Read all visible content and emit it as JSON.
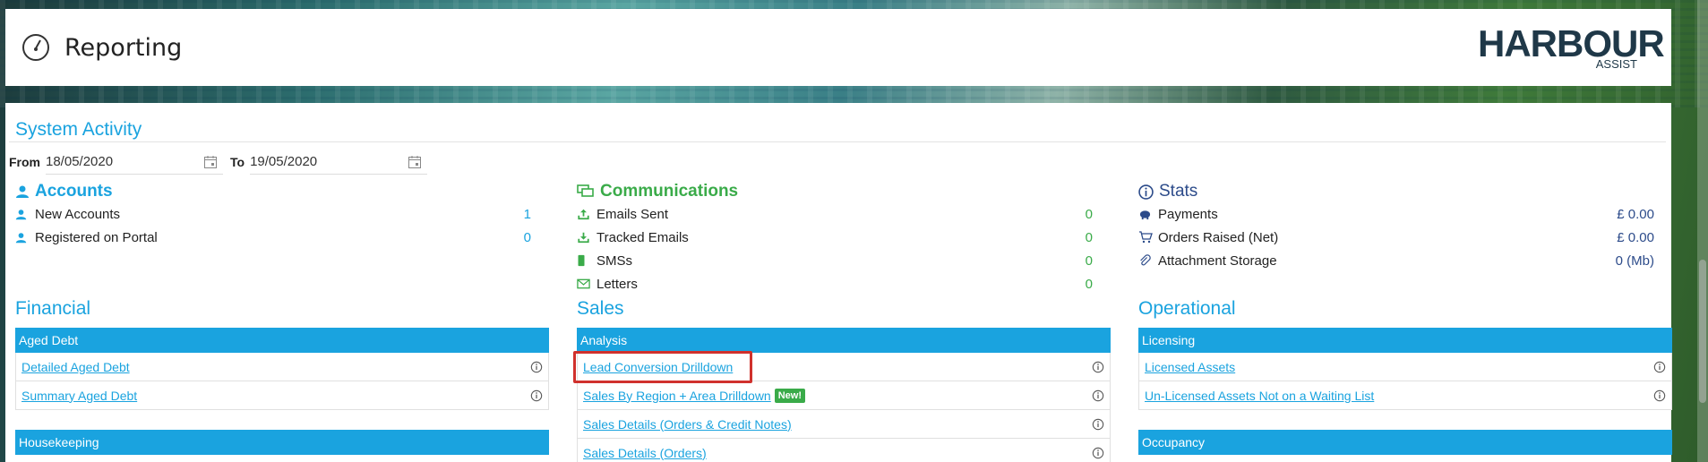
{
  "header": {
    "title": "Reporting",
    "logo_main": "HARBOUR",
    "logo_sub": "ASSIST"
  },
  "system_activity": {
    "title": "System Activity",
    "from_label": "From",
    "from_value": "18/05/2020",
    "to_label": "To",
    "to_value": "19/05/2020"
  },
  "accounts": {
    "title": "Accounts",
    "rows": [
      {
        "label": "New Accounts",
        "value": "1"
      },
      {
        "label": "Registered on Portal",
        "value": "0"
      }
    ]
  },
  "communications": {
    "title": "Communications",
    "rows": [
      {
        "label": "Emails Sent",
        "value": "0"
      },
      {
        "label": "Tracked Emails",
        "value": "0"
      },
      {
        "label": "SMSs",
        "value": "0"
      },
      {
        "label": "Letters",
        "value": "0"
      }
    ]
  },
  "stats": {
    "title": "Stats",
    "rows": [
      {
        "label": "Payments",
        "value": "£ 0.00"
      },
      {
        "label": "Orders Raised (Net)",
        "value": "£ 0.00"
      },
      {
        "label": "Attachment Storage",
        "value": "0 (Mb)"
      }
    ]
  },
  "financial": {
    "title": "Financial",
    "aged_debt": {
      "header": "Aged Debt",
      "links": [
        "Detailed Aged Debt",
        "Summary Aged Debt"
      ]
    },
    "housekeeping": {
      "header": "Housekeeping"
    }
  },
  "sales": {
    "title": "Sales",
    "analysis": {
      "header": "Analysis",
      "links": [
        "Lead Conversion Drilldown",
        "Sales By Region + Area Drilldown",
        "Sales Details (Orders & Credit Notes)",
        "Sales Details (Orders)"
      ],
      "new_badge": "New!"
    }
  },
  "operational": {
    "title": "Operational",
    "licensing": {
      "header": "Licensing",
      "links": [
        "Licensed Assets",
        "Un-Licensed Assets Not on a Waiting List"
      ]
    },
    "occupancy": {
      "header": "Occupancy"
    }
  },
  "colors": {
    "accent": "#1aa3df",
    "comm": "#3aab49",
    "stats": "#2c4b8a",
    "highlight": "#d0312d"
  }
}
